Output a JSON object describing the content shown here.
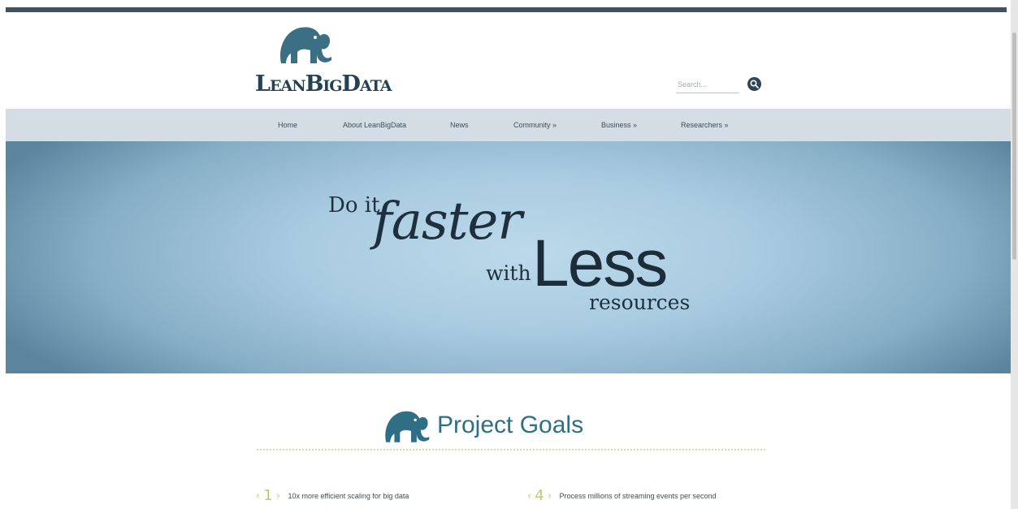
{
  "logo": {
    "text": "LeanBigData"
  },
  "search": {
    "placeholder": "Search..."
  },
  "nav": {
    "items": [
      {
        "label": "Home"
      },
      {
        "label": "About LeanBigData"
      },
      {
        "label": "News"
      },
      {
        "label": "Community »"
      },
      {
        "label": "Business »"
      },
      {
        "label": "Researchers »"
      }
    ]
  },
  "hero": {
    "line_doit": "Do it",
    "line_faster": "faster",
    "line_with": "with",
    "line_less": "Less",
    "line_resources": "resources"
  },
  "goals": {
    "title": "Project Goals",
    "items": [
      {
        "number": "1",
        "text": "10x more efficient scaling for big data"
      },
      {
        "number": "4",
        "text": "Process millions of streaming events per second"
      }
    ]
  },
  "colors": {
    "brand_dark": "#244254",
    "accent_teal": "#2f6f86",
    "goal_number": "#c2c77a",
    "nav_bg": "#d4dde3"
  },
  "icons": {
    "logo": "elephant-icon",
    "search": "search-icon"
  }
}
